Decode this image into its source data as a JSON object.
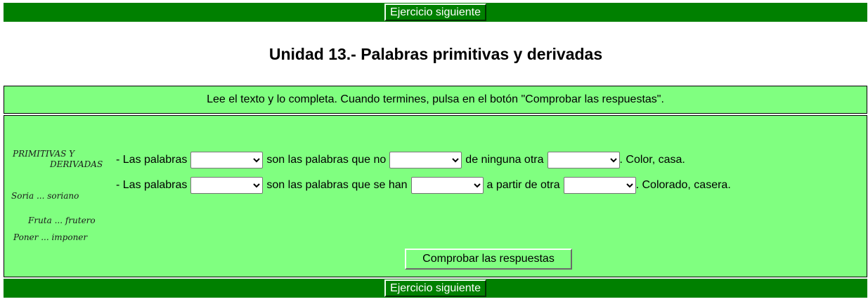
{
  "nav": {
    "next_label": "Ejercicio siguiente"
  },
  "title": "Unidad 13.- Palabras primitivas y derivadas",
  "instructions": "Lee el texto y lo completa. Cuando termines, pulsa en el botón \"Comprobar las respuestas\".",
  "illustration": {
    "line1": "PRIMITIVAS Y",
    "line2": "DERIVADAS",
    "ex1": "Soria ... soriano",
    "ex2": "Fruta ... frutero",
    "ex3": "Poner ... imponer"
  },
  "sentence1": {
    "p1": "- Las palabras",
    "p2": "son las palabras que no",
    "p3": "de ninguna otra",
    "p4": ". Color, casa."
  },
  "sentence2": {
    "p1": "- Las palabras",
    "p2": "son las palabras que se han",
    "p3": "a partir de otra",
    "p4": ". Colorado, casera."
  },
  "check_label": "Comprobar las respuestas"
}
